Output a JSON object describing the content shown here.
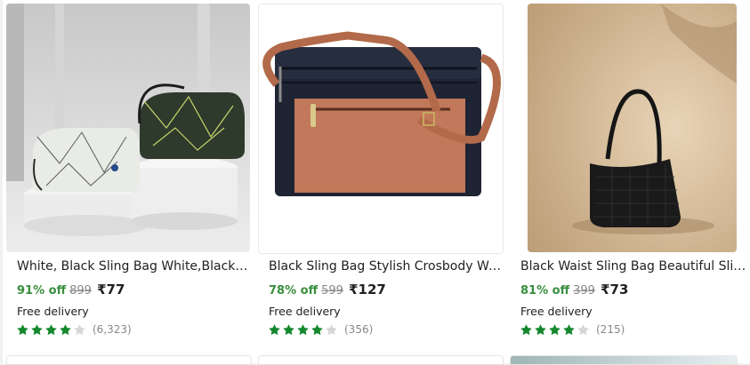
{
  "products": [
    {
      "title": "White, Black Sling Bag White,Black Sli...",
      "discount": "91% off",
      "mrp": "899",
      "price": "₹77",
      "delivery": "Free delivery",
      "rating": 4,
      "rating_count": "(6,323)"
    },
    {
      "title": "Black Sling Bag Stylish Crosbody Wo...",
      "discount": "78% off",
      "mrp": "599",
      "price": "₹127",
      "delivery": "Free delivery",
      "rating": 4,
      "rating_count": "(356)"
    },
    {
      "title": "Black Waist Sling Bag Beautiful Sling ...",
      "discount": "81% off",
      "mrp": "399",
      "price": "₹73",
      "delivery": "Free delivery",
      "rating": 4,
      "rating_count": "(215)"
    }
  ],
  "colors": {
    "discount": "#388e3c",
    "star_filled": "#14882d",
    "star_empty": "#d6d6d6"
  }
}
